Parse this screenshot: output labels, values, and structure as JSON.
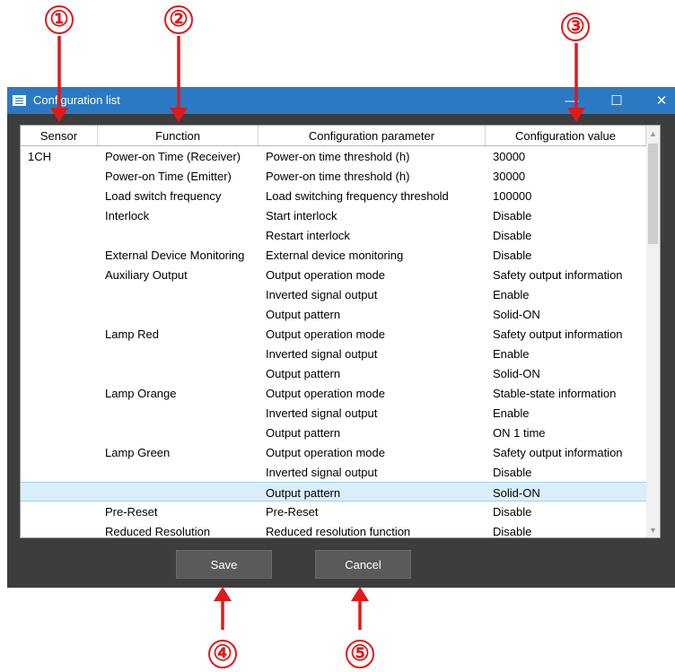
{
  "callouts": [
    "①",
    "②",
    "③",
    "④",
    "⑤"
  ],
  "window": {
    "title": "Configuration list",
    "minimize_glyph": "—",
    "maximize_glyph": "☐",
    "close_glyph": "✕"
  },
  "table": {
    "columns": [
      "Sensor",
      "Function",
      "Configuration parameter",
      "Configuration value"
    ],
    "rows": [
      {
        "sensor": "1CH",
        "function": "Power-on Time (Receiver)",
        "parameter": "Power-on time threshold (h)",
        "value": "30000"
      },
      {
        "sensor": "",
        "function": "Power-on Time (Emitter)",
        "parameter": "Power-on time threshold (h)",
        "value": "30000"
      },
      {
        "sensor": "",
        "function": "Load switch frequency",
        "parameter": "Load switching frequency threshold",
        "value": "100000"
      },
      {
        "sensor": "",
        "function": "Interlock",
        "parameter": "Start interlock",
        "value": "Disable"
      },
      {
        "sensor": "",
        "function": "",
        "parameter": "Restart interlock",
        "value": "Disable"
      },
      {
        "sensor": "",
        "function": "External Device Monitoring",
        "parameter": "External device monitoring",
        "value": "Disable"
      },
      {
        "sensor": "",
        "function": "Auxiliary Output",
        "parameter": "Output operation mode",
        "value": "Safety output  information"
      },
      {
        "sensor": "",
        "function": "",
        "parameter": "Inverted signal output",
        "value": "Enable"
      },
      {
        "sensor": "",
        "function": "",
        "parameter": "Output pattern",
        "value": "Solid-ON"
      },
      {
        "sensor": "",
        "function": "Lamp Red",
        "parameter": "Output operation mode",
        "value": "Safety output  information"
      },
      {
        "sensor": "",
        "function": "",
        "parameter": "Inverted signal output",
        "value": "Enable"
      },
      {
        "sensor": "",
        "function": "",
        "parameter": "Output pattern",
        "value": "Solid-ON"
      },
      {
        "sensor": "",
        "function": "Lamp Orange",
        "parameter": "Output operation mode",
        "value": "Stable-state information"
      },
      {
        "sensor": "",
        "function": "",
        "parameter": "Inverted signal output",
        "value": "Enable"
      },
      {
        "sensor": "",
        "function": "",
        "parameter": "Output pattern",
        "value": "ON 1 time"
      },
      {
        "sensor": "",
        "function": "Lamp Green",
        "parameter": "Output operation mode",
        "value": "Safety output  information"
      },
      {
        "sensor": "",
        "function": "",
        "parameter": "Inverted signal output",
        "value": "Disable"
      },
      {
        "sensor": "",
        "function": "",
        "parameter": "Output pattern",
        "value": "Solid-ON",
        "selected": true
      },
      {
        "sensor": "",
        "function": "Pre-Reset",
        "parameter": "Pre-Reset",
        "value": "Disable"
      },
      {
        "sensor": "",
        "function": "Reduced Resolution",
        "parameter": "Reduced resolution function",
        "value": "Disable"
      }
    ]
  },
  "buttons": {
    "save": "Save",
    "cancel": "Cancel"
  },
  "colors": {
    "titlebar": "#2b79c2",
    "window_bg": "#3d3d3d",
    "callout": "#e0191a",
    "selected_row": "#d9eef9"
  }
}
